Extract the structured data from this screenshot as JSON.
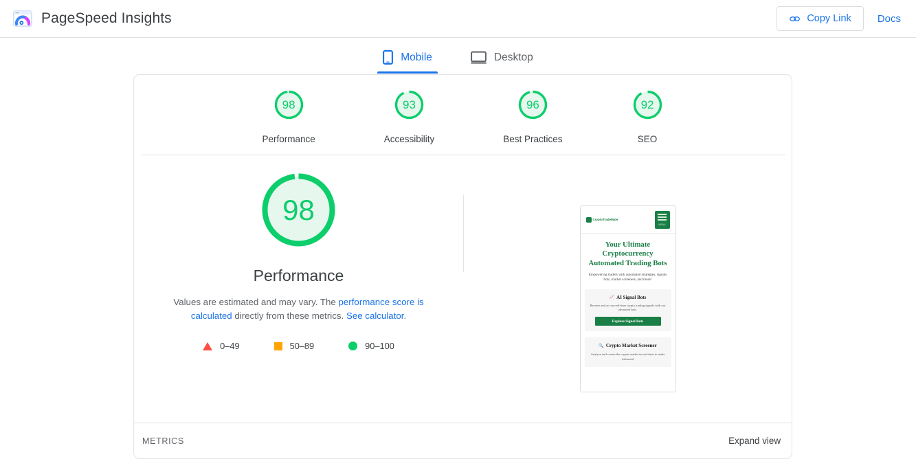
{
  "header": {
    "logo_icon": "pagespeed-insights-logo",
    "title": "PageSpeed Insights",
    "copy_link_label": "Copy Link",
    "copy_link_icon": "link-icon",
    "docs_label": "Docs"
  },
  "tabs": [
    {
      "label": "Mobile",
      "icon": "mobile-phone-icon",
      "active": true
    },
    {
      "label": "Desktop",
      "icon": "desktop-monitor-icon",
      "active": false
    }
  ],
  "summary_scores": [
    {
      "value": "98",
      "label": "Performance"
    },
    {
      "value": "93",
      "label": "Accessibility"
    },
    {
      "value": "96",
      "label": "Best Practices"
    },
    {
      "value": "92",
      "label": "SEO"
    }
  ],
  "performance": {
    "score": "98",
    "title": "Performance",
    "description_part1": "Values are estimated and may vary. The ",
    "link1": "performance score is calculated",
    "description_part2": " directly from these metrics. ",
    "link2": "See calculator",
    "description_part3": "."
  },
  "legend": [
    {
      "icon": "red-triangle-swatch",
      "range": "0–49"
    },
    {
      "icon": "orange-square-swatch",
      "range": "50–89"
    },
    {
      "icon": "green-circle-swatch",
      "range": "90–100"
    }
  ],
  "thumbnail": {
    "logo_text": "CryptoTradeMate",
    "menu_label": "MENU",
    "heading": "Your Ultimate Cryptocurrency Automated Trading Bots",
    "subheading": "Empowering traders with automated strategies, signals bots, market screeners, and more!",
    "card1_title": "AI Signal Bots",
    "card1_icon": "chart-up-icon",
    "card1_text": "Receive and act on real-time crypto trading signals with our advanced bots.",
    "card1_button": "Explore Signal Bots",
    "card2_title": "Crypto Market Screener",
    "card2_icon": "magnifier-icon",
    "card2_text": "Analyze and screen the crypto market in real-time to make informed"
  },
  "footer": {
    "metrics_label": "METRICS",
    "expand_view_label": "Expand view"
  },
  "colors": {
    "pass_green": "#0cce6b",
    "pass_green_bg": "#e6f7ee",
    "average_orange": "#ffa400",
    "fail_red": "#ff4e42",
    "accent_blue": "#1a73e8"
  }
}
